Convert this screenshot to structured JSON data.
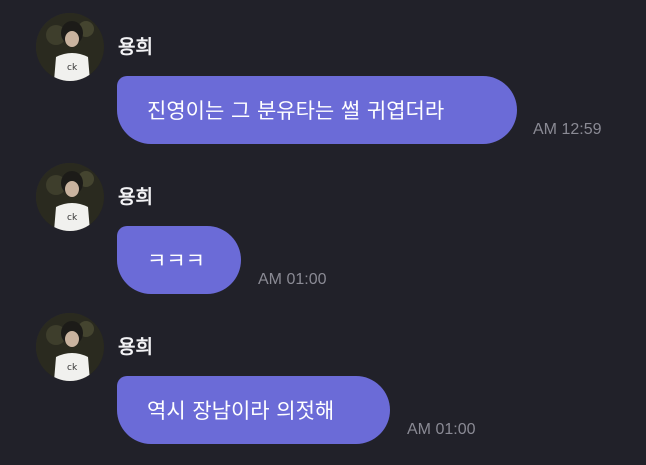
{
  "messages": [
    {
      "sender": "용희",
      "text": "진영이는 그 분유타는 썰 귀엽더라",
      "time": "AM 12:59"
    },
    {
      "sender": "용희",
      "text": "ㅋㅋㅋ",
      "time": "AM 01:00"
    },
    {
      "sender": "용희",
      "text": "역시 장남이라 의젓해",
      "time": "AM 01:00"
    }
  ],
  "colors": {
    "background": "#212129",
    "bubble": "#6b6bd7",
    "timestamp": "#8a8a94"
  },
  "icons": {
    "avatar": "profile-photo"
  }
}
